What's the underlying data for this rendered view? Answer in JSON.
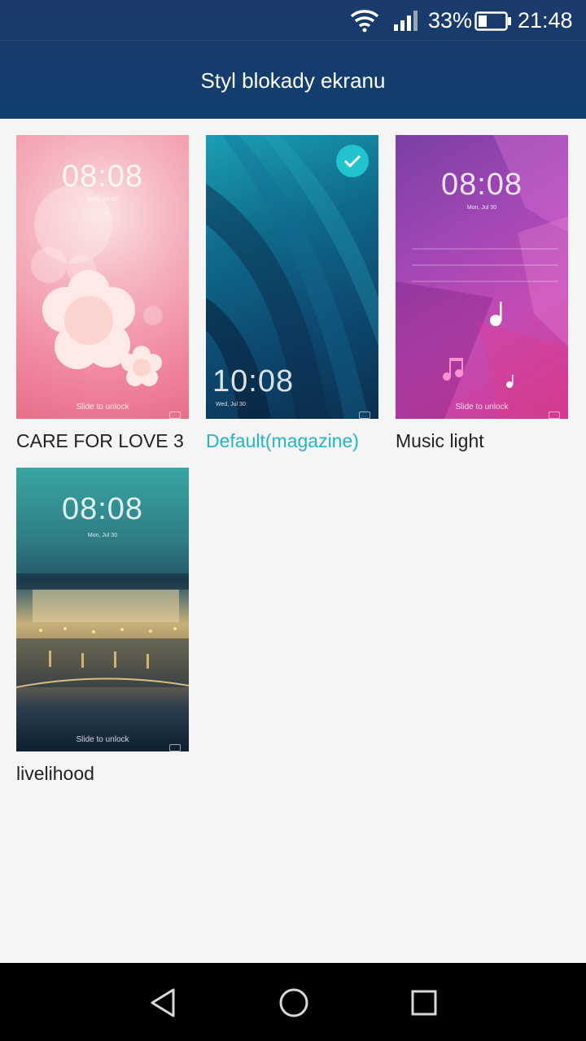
{
  "status_bar": {
    "battery_percent": "33%",
    "time": "21:48",
    "icons": [
      "wifi-icon",
      "signal-icon",
      "battery-icon"
    ]
  },
  "header": {
    "title": "Styl blokady ekranu"
  },
  "colors": {
    "accent": "#21b7c4",
    "header": "#163b6c",
    "background": "#f5f5f5"
  },
  "themes": [
    {
      "name": "CARE FOR LOVE 3",
      "preview_time": "08:08",
      "preview_date": "Mon, Jul 30",
      "preview_hint": "Slide to unlock",
      "selected": false
    },
    {
      "name": "Default(magazine)",
      "preview_time": "10:08",
      "preview_date": "Wed, Jul 30",
      "preview_hint": "",
      "selected": true
    },
    {
      "name": "Music light",
      "preview_time": "08:08",
      "preview_date": "Mon, Jul 30",
      "preview_hint": "Slide to unlock",
      "selected": false
    },
    {
      "name": "livelihood",
      "preview_time": "08:08",
      "preview_date": "Mon, Jul 30",
      "preview_hint": "Slide to unlock",
      "selected": false
    }
  ],
  "nav_bar": {
    "buttons": [
      "back-icon",
      "home-icon",
      "recents-icon"
    ]
  }
}
